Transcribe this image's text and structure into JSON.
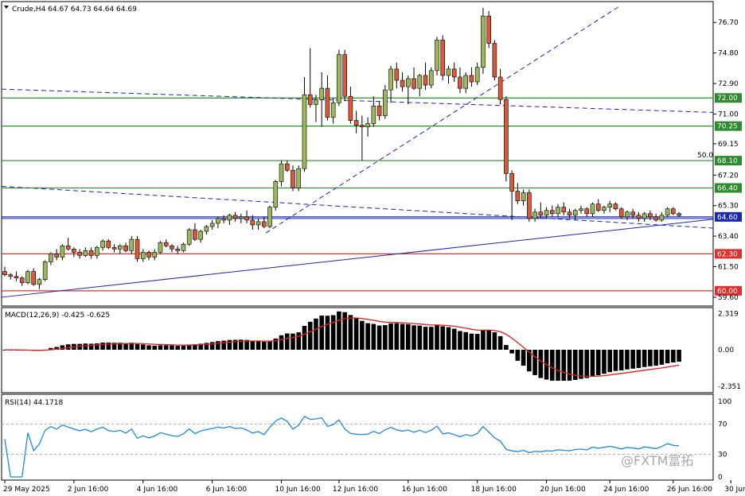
{
  "header": {
    "title": "Crude,H4  64.67 64.73 64.64 64.69",
    "macd_label": "MACD(12,26,9) -0.425 -0.625",
    "rsi_label": "RSI(14) 44.1718"
  },
  "watermark": "@FXTM富拓",
  "fib_label": "50.0",
  "colors": {
    "bull": "#9bb85a",
    "bear": "#d9593b",
    "support_green": "#2e8b2e",
    "support_red": "#e03030",
    "trend_blue": "#1a27b0",
    "macd_signal": "#e02020",
    "rsi_line": "#2288dd",
    "highlight_tag": "#1a27b0"
  },
  "chart_data": [
    {
      "type": "candlestick",
      "title": "Crude,H4",
      "ohlc_last": {
        "open": 64.67,
        "high": 64.73,
        "low": 64.64,
        "close": 64.69
      },
      "y_ticks": [
        76.7,
        74.8,
        72.9,
        71.0,
        69.15,
        67.2,
        65.3,
        63.4,
        61.5,
        59.6
      ],
      "y_tick_labels": [
        "76.70",
        "74.80",
        "72.90",
        "71.00",
        "69.15",
        "67.20",
        "65.30",
        "63.40",
        "61.50",
        "59.60"
      ],
      "ylim": [
        59.3,
        77.7
      ],
      "x_tick_labels": [
        "29 May 2025",
        "2 Jun 16:00",
        "4 Jun 16:00",
        "6 Jun 16:00",
        "10 Jun 16:00",
        "12 Jun 16:00",
        "16 Jun 16:00",
        "18 Jun 16:00",
        "20 Jun 16:00",
        "24 Jun 16:00",
        "26 Jun 16:00",
        "30 Jun 16:00"
      ],
      "levels": [
        {
          "value": 72.0,
          "label": "72.00",
          "color": "green"
        },
        {
          "value": 70.25,
          "label": "70.25",
          "color": "green"
        },
        {
          "value": 68.1,
          "label": "68.10",
          "color": "green"
        },
        {
          "value": 66.4,
          "label": "66.40",
          "color": "green"
        },
        {
          "value": 64.6,
          "label": "64.60",
          "color": "blue",
          "highlighted": true
        },
        {
          "value": 62.3,
          "label": "62.30",
          "color": "red"
        },
        {
          "value": 60.0,
          "label": "60.00",
          "color": "red"
        }
      ],
      "candles": [
        [
          61.2,
          61.5,
          60.9,
          61.0
        ],
        [
          61.0,
          61.1,
          60.7,
          60.9
        ],
        [
          60.9,
          61.2,
          60.6,
          60.8
        ],
        [
          60.8,
          60.9,
          60.3,
          60.5
        ],
        [
          60.5,
          61.3,
          60.4,
          61.2
        ],
        [
          61.2,
          61.4,
          60.3,
          60.4
        ],
        [
          60.4,
          60.8,
          60.1,
          60.7
        ],
        [
          60.7,
          61.9,
          60.6,
          61.8
        ],
        [
          61.8,
          62.4,
          61.6,
          62.3
        ],
        [
          62.3,
          62.6,
          61.9,
          62.1
        ],
        [
          62.1,
          62.9,
          61.9,
          62.8
        ],
        [
          62.8,
          63.3,
          62.5,
          62.6
        ],
        [
          62.6,
          62.7,
          62.1,
          62.4
        ],
        [
          62.4,
          62.6,
          62.0,
          62.2
        ],
        [
          62.2,
          62.7,
          62.1,
          62.5
        ],
        [
          62.5,
          62.7,
          62.0,
          62.2
        ],
        [
          62.2,
          62.8,
          62.0,
          62.7
        ],
        [
          62.7,
          63.2,
          62.5,
          63.1
        ],
        [
          63.1,
          63.2,
          62.6,
          62.7
        ],
        [
          62.7,
          62.9,
          62.4,
          62.6
        ],
        [
          62.6,
          62.9,
          62.3,
          62.8
        ],
        [
          62.8,
          63.0,
          62.4,
          62.5
        ],
        [
          62.5,
          63.4,
          62.3,
          63.2
        ],
        [
          63.2,
          63.4,
          61.8,
          62.0
        ],
        [
          62.0,
          62.6,
          61.8,
          62.4
        ],
        [
          62.4,
          62.5,
          61.9,
          62.1
        ],
        [
          62.1,
          62.6,
          61.9,
          62.4
        ],
        [
          62.4,
          63.1,
          62.3,
          63.0
        ],
        [
          63.0,
          63.2,
          62.7,
          62.8
        ],
        [
          62.8,
          62.9,
          62.4,
          62.6
        ],
        [
          62.6,
          62.8,
          62.3,
          62.5
        ],
        [
          62.5,
          63.0,
          62.4,
          62.9
        ],
        [
          62.9,
          63.9,
          62.8,
          63.8
        ],
        [
          63.8,
          64.2,
          63.1,
          63.2
        ],
        [
          63.2,
          63.8,
          63.0,
          63.7
        ],
        [
          63.7,
          64.1,
          63.5,
          64.0
        ],
        [
          64.0,
          64.4,
          63.8,
          64.2
        ],
        [
          64.2,
          64.6,
          63.9,
          64.5
        ],
        [
          64.5,
          64.7,
          64.2,
          64.4
        ],
        [
          64.4,
          64.8,
          64.1,
          64.7
        ],
        [
          64.7,
          64.9,
          64.3,
          64.5
        ],
        [
          64.5,
          64.8,
          64.2,
          64.6
        ],
        [
          64.6,
          65.0,
          64.2,
          64.4
        ],
        [
          64.4,
          64.7,
          63.8,
          64.1
        ],
        [
          64.1,
          64.5,
          63.8,
          64.3
        ],
        [
          64.3,
          64.6,
          63.9,
          64.0
        ],
        [
          64.0,
          65.3,
          63.9,
          65.2
        ],
        [
          65.2,
          66.9,
          65.0,
          66.8
        ],
        [
          66.8,
          68.1,
          66.5,
          67.9
        ],
        [
          67.9,
          68.1,
          67.4,
          67.5
        ],
        [
          67.5,
          67.8,
          66.2,
          66.4
        ],
        [
          66.4,
          67.8,
          66.2,
          67.6
        ],
        [
          67.6,
          73.3,
          67.4,
          72.2
        ],
        [
          72.2,
          75.1,
          71.4,
          71.6
        ],
        [
          71.6,
          72.2,
          70.5,
          71.9
        ],
        [
          71.9,
          73.6,
          70.2,
          72.6
        ],
        [
          72.6,
          73.4,
          70.6,
          70.8
        ],
        [
          70.8,
          72.0,
          70.4,
          71.7
        ],
        [
          71.7,
          75.0,
          71.5,
          74.7
        ],
        [
          74.7,
          75.0,
          71.8,
          72.1
        ],
        [
          72.1,
          72.7,
          70.4,
          70.6
        ],
        [
          70.6,
          71.2,
          69.8,
          70.3
        ],
        [
          70.3,
          70.9,
          68.1,
          70.2
        ],
        [
          70.2,
          70.8,
          69.6,
          70.4
        ],
        [
          70.4,
          72.1,
          70.2,
          71.5
        ],
        [
          71.5,
          71.8,
          70.6,
          70.9
        ],
        [
          70.9,
          72.8,
          70.7,
          72.5
        ],
        [
          72.5,
          74.0,
          71.7,
          73.8
        ],
        [
          73.8,
          74.2,
          72.6,
          73.1
        ],
        [
          73.1,
          73.6,
          72.4,
          72.7
        ],
        [
          72.7,
          73.4,
          71.6,
          73.2
        ],
        [
          73.2,
          73.9,
          72.5,
          72.6
        ],
        [
          72.6,
          73.5,
          72.1,
          73.4
        ],
        [
          73.4,
          74.2,
          72.5,
          72.8
        ],
        [
          72.8,
          73.9,
          72.6,
          73.7
        ],
        [
          73.7,
          75.8,
          73.4,
          75.6
        ],
        [
          75.6,
          75.9,
          73.1,
          73.4
        ],
        [
          73.4,
          74.0,
          72.9,
          73.8
        ],
        [
          73.8,
          74.2,
          73.0,
          73.3
        ],
        [
          73.3,
          73.9,
          72.3,
          72.6
        ],
        [
          72.6,
          73.6,
          72.3,
          73.4
        ],
        [
          73.4,
          73.9,
          72.7,
          73.0
        ],
        [
          73.0,
          74.2,
          72.8,
          73.9
        ],
        [
          73.9,
          77.6,
          73.5,
          77.1
        ],
        [
          77.1,
          77.4,
          75.1,
          75.4
        ],
        [
          75.4,
          75.6,
          73.1,
          73.3
        ],
        [
          73.3,
          73.8,
          71.6,
          71.9
        ],
        [
          71.9,
          72.1,
          66.8,
          67.3
        ],
        [
          67.3,
          67.5,
          64.4,
          66.2
        ],
        [
          66.2,
          66.7,
          65.4,
          65.6
        ],
        [
          65.6,
          66.3,
          65.3,
          66.1
        ],
        [
          66.1,
          66.3,
          64.3,
          64.5
        ],
        [
          64.5,
          65.1,
          64.3,
          64.9
        ],
        [
          64.9,
          65.5,
          64.5,
          64.7
        ],
        [
          64.7,
          65.2,
          64.5,
          65.0
        ],
        [
          65.0,
          65.3,
          64.6,
          64.8
        ],
        [
          64.8,
          65.4,
          64.6,
          65.2
        ],
        [
          65.2,
          65.5,
          64.7,
          64.9
        ],
        [
          64.9,
          65.1,
          64.5,
          64.7
        ],
        [
          64.7,
          65.1,
          64.4,
          65.0
        ],
        [
          65.0,
          65.3,
          64.8,
          65.1
        ],
        [
          65.1,
          65.2,
          64.6,
          64.8
        ],
        [
          64.8,
          65.5,
          64.6,
          65.4
        ],
        [
          65.4,
          65.7,
          64.9,
          65.0
        ],
        [
          65.0,
          65.3,
          64.8,
          65.2
        ],
        [
          65.2,
          65.6,
          64.9,
          65.4
        ],
        [
          65.4,
          65.5,
          65.0,
          65.1
        ],
        [
          65.1,
          65.2,
          64.5,
          64.6
        ],
        [
          64.6,
          65.0,
          64.4,
          64.9
        ],
        [
          64.9,
          65.1,
          64.5,
          64.7
        ],
        [
          64.7,
          64.9,
          64.3,
          64.5
        ],
        [
          64.5,
          64.9,
          64.3,
          64.8
        ],
        [
          64.8,
          65.0,
          64.4,
          64.6
        ],
        [
          64.6,
          64.8,
          64.3,
          64.4
        ],
        [
          64.4,
          64.9,
          64.3,
          64.7
        ],
        [
          64.7,
          65.2,
          64.6,
          65.1
        ],
        [
          65.1,
          65.2,
          64.7,
          64.8
        ],
        [
          64.8,
          64.9,
          64.6,
          64.69
        ]
      ]
    },
    {
      "type": "histogram+line",
      "name": "MACD(12,26,9)",
      "y_tick_labels": [
        "2.319",
        "0.00",
        "-2.351"
      ],
      "ylim": [
        -2.65,
        2.55
      ],
      "macd_last": -0.425,
      "signal_last": -0.625
    },
    {
      "type": "line",
      "name": "RSI(14)",
      "value_last": 44.1718,
      "y_tick_labels": [
        "100",
        "70",
        "30",
        "0"
      ],
      "ylim": [
        0,
        100
      ],
      "levels": [
        70,
        30
      ]
    }
  ]
}
